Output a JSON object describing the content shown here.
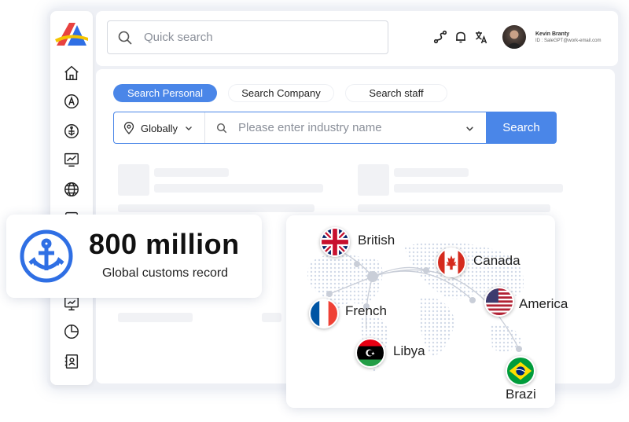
{
  "search": {
    "placeholder": "Quick search"
  },
  "user": {
    "name": "Kevin Branty",
    "id_line": "ID : SaleGPT@work-email.com"
  },
  "tabs": [
    {
      "label": "Search Personal",
      "active": true
    },
    {
      "label": "Search Company",
      "active": false
    },
    {
      "label": "Search staff",
      "active": false
    }
  ],
  "query": {
    "region": "Globally",
    "industry_placeholder": "Please enter industry name",
    "search_label": "Search"
  },
  "stat": {
    "value": "800 million",
    "label": "Global customs record"
  },
  "countries": [
    {
      "name": "British",
      "flag": "uk-flag-icon"
    },
    {
      "name": "Canada",
      "flag": "canada-flag-icon"
    },
    {
      "name": "America",
      "flag": "usa-flag-icon"
    },
    {
      "name": "French",
      "flag": "france-flag-icon"
    },
    {
      "name": "Libya",
      "flag": "libya-flag-icon"
    },
    {
      "name": "Brazi",
      "flag": "brazil-flag-icon"
    }
  ],
  "colors": {
    "accent": "#4a86e8",
    "logo_blue": "#2f6fe4",
    "logo_yellow": "#f5c400",
    "logo_red": "#e8423f"
  },
  "sidebar_icons": [
    "home-icon",
    "font-a-icon",
    "anchor-icon",
    "chart-icon",
    "globe-icon",
    "monitor-chart-icon",
    "pie-chart-icon",
    "contacts-icon"
  ]
}
